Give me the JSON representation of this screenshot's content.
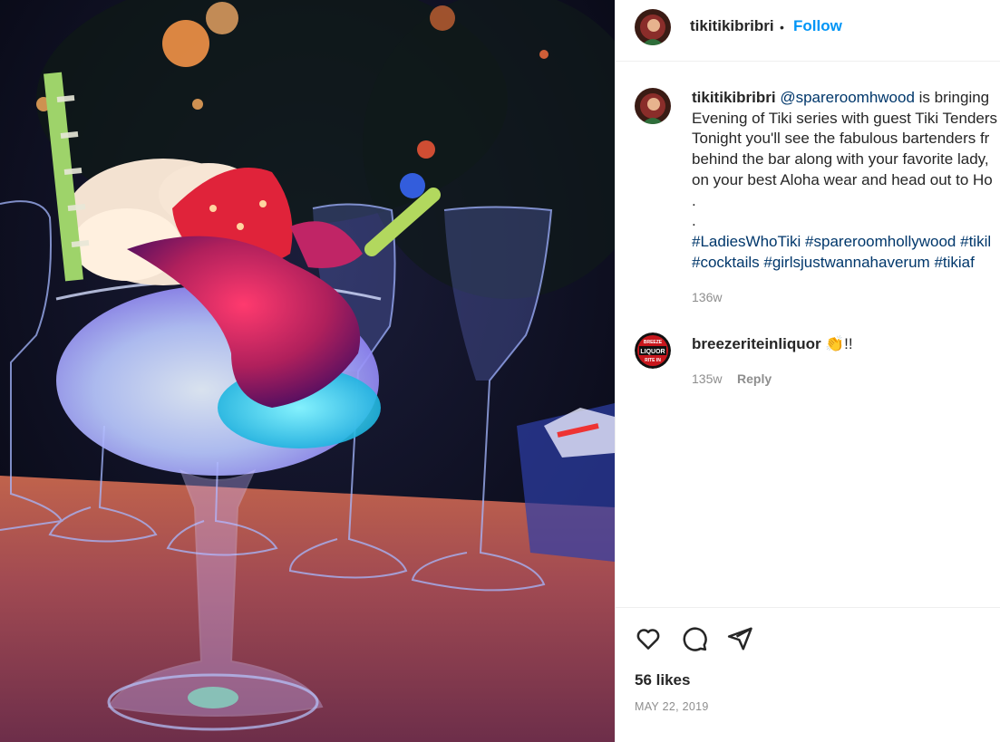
{
  "post": {
    "author": "tikitikibribri",
    "follow_label": "Follow",
    "separator": "•",
    "caption": {
      "mention": "@spareroomhwood",
      "line1_rest": " is bringing",
      "line2": "Evening of Tiki series with guest Tiki Tenders",
      "line3": "Tonight you'll see the fabulous bartenders fr",
      "line4": "behind the bar along with your favorite lady,",
      "line5": "on your best Aloha wear and head out to Ho",
      "dot1": ".",
      "dot2": ".",
      "hashtags_line1": [
        "#LadiesWhoTiki",
        "#spareroomhollywood",
        "#tikil"
      ],
      "hashtags_line2": [
        "#cocktails",
        "#girlsjustwannahaverum",
        "#tikiaf"
      ],
      "age": "136w"
    },
    "comment": {
      "author": "breezeriteinliquor",
      "text": "👏!!",
      "age": "135w",
      "reply_label": "Reply",
      "avatar_text": [
        "BREEZE",
        "LIQUOR",
        "RITE IN"
      ]
    },
    "likes": "56 likes",
    "date": "MAY 22, 2019",
    "icons": [
      "heart-icon",
      "comment-icon",
      "share-icon"
    ]
  }
}
